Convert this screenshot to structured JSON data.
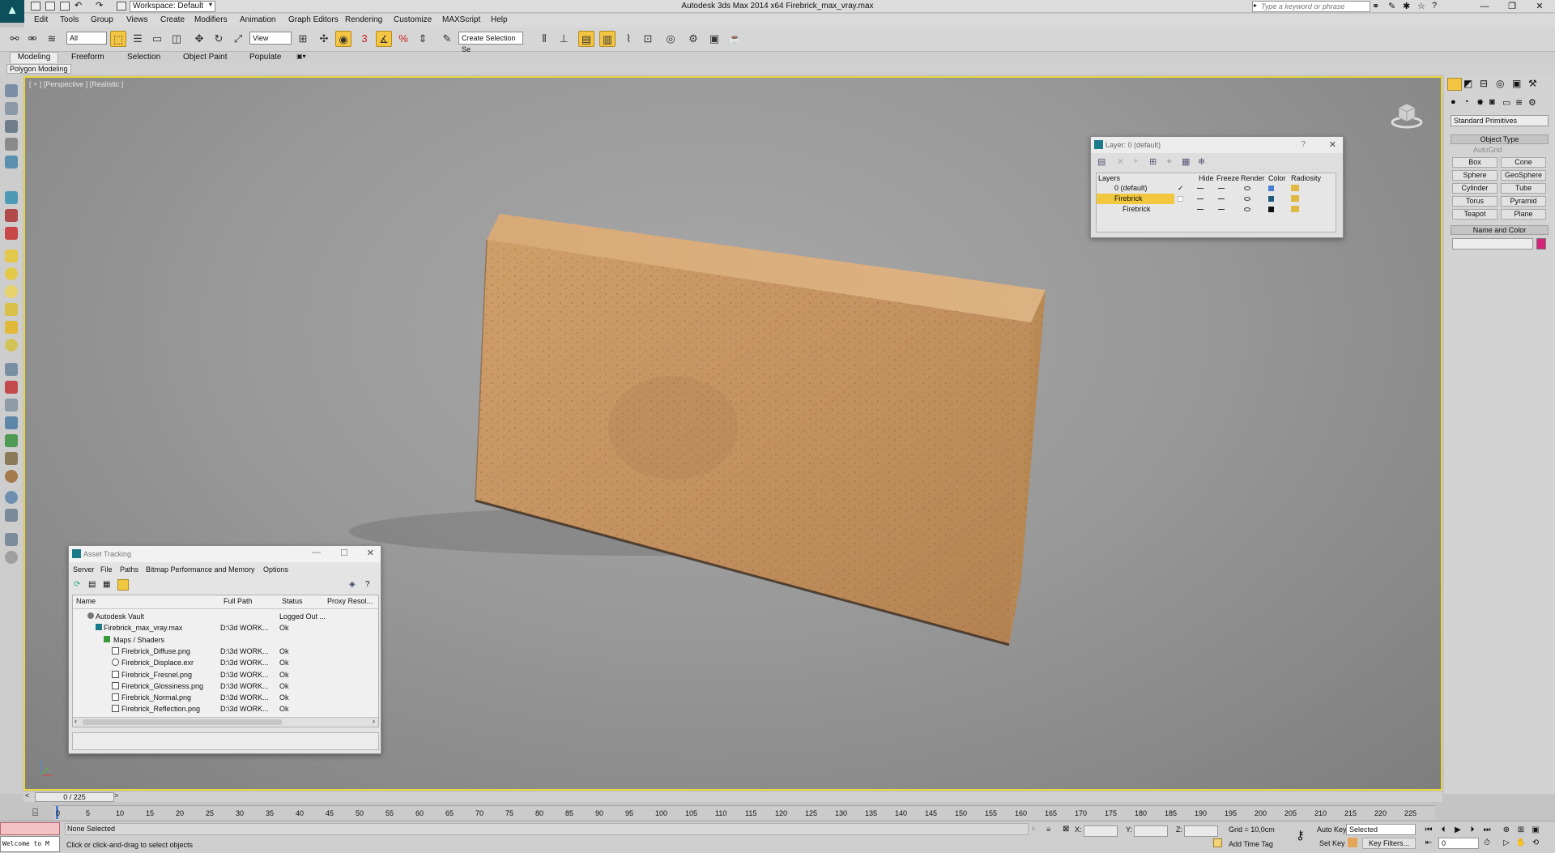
{
  "titlebar": {
    "workspace": "Workspace: Default",
    "title": "Autodesk 3ds Max  2014 x64      Firebrick_max_vray.max",
    "search_placeholder": "Type a keyword or phrase",
    "minimize": "—",
    "restore": "❐",
    "close": "✕"
  },
  "menu": [
    "Edit",
    "Tools",
    "Group",
    "Views",
    "Create",
    "Modifiers",
    "Animation",
    "Graph Editors",
    "Rendering",
    "Customize",
    "MAXScript",
    "Help"
  ],
  "toolbar": {
    "filter": "All",
    "ref_coord": "View",
    "selection_set": "Create Selection Se",
    "snap_label": "3"
  },
  "ribbon": {
    "tabs": [
      "Modeling",
      "Freeform",
      "Selection",
      "Object Paint",
      "Populate"
    ],
    "sub_label": "Polygon Modeling"
  },
  "viewport": {
    "label": "[ + ] [Perspective ] [Realistic ]"
  },
  "layer_dialog": {
    "title": "Layer: 0 (default)",
    "help": "?",
    "close": "✕",
    "columns": [
      "Layers",
      "Hide",
      "Freeze",
      "Render",
      "Color",
      "Radiosity"
    ],
    "rows": [
      {
        "name": "0 (default)",
        "check": "✓",
        "color": "#4a7fd0"
      },
      {
        "name": "Firebrick",
        "check": "",
        "color": "#1e5c7c"
      },
      {
        "name": "Firebrick",
        "check": "",
        "color": "#111111"
      }
    ],
    "collapse": "⊟"
  },
  "asset_tracking": {
    "title": "Asset Tracking",
    "menu": [
      "Server",
      "File",
      "Paths",
      "Bitmap Performance and Memory",
      "Options"
    ],
    "columns": [
      "Name",
      "Full Path",
      "Status",
      "Proxy Resol..."
    ],
    "rows": [
      {
        "name": "Autodesk Vault",
        "path": "",
        "status": "Logged Out ..."
      },
      {
        "name": "Firebrick_max_vray.max",
        "path": "D:\\3d WORK...",
        "status": "Ok"
      },
      {
        "name": "Maps / Shaders",
        "path": "",
        "status": ""
      },
      {
        "name": "Firebrick_Diffuse.png",
        "path": "D:\\3d WORK...",
        "status": "Ok"
      },
      {
        "name": "Firebrick_Displace.exr",
        "path": "D:\\3d WORK...",
        "status": "Ok"
      },
      {
        "name": "Firebrick_Fresnel.png",
        "path": "D:\\3d WORK...",
        "status": "Ok"
      },
      {
        "name": "Firebrick_Glossiness.png",
        "path": "D:\\3d WORK...",
        "status": "Ok"
      },
      {
        "name": "Firebrick_Normal.png",
        "path": "D:\\3d WORK...",
        "status": "Ok"
      },
      {
        "name": "Firebrick_Reflection.png",
        "path": "D:\\3d WORK...",
        "status": "Ok"
      }
    ]
  },
  "command_panel": {
    "category": "Standard Primitives",
    "object_type": "Object Type",
    "autogrid": "AutoGrid",
    "buttons": [
      "Box",
      "Cone",
      "Sphere",
      "GeoSphere",
      "Cylinder",
      "Tube",
      "Torus",
      "Pyramid",
      "Teapot",
      "Plane"
    ],
    "name_and_color": "Name and Color",
    "object_color": "#d6247a"
  },
  "timeline": {
    "frame": "0 / 225",
    "ticks": [
      "0",
      "5",
      "10",
      "15",
      "20",
      "25",
      "30",
      "35",
      "40",
      "45",
      "50",
      "55",
      "60",
      "65",
      "70",
      "75",
      "80",
      "85",
      "90",
      "95",
      "100",
      "105",
      "110",
      "115",
      "120",
      "125",
      "130",
      "135",
      "140",
      "145",
      "150",
      "155",
      "160",
      "165",
      "170",
      "175",
      "180",
      "185",
      "190",
      "195",
      "200",
      "205",
      "210",
      "215",
      "220",
      "225"
    ]
  },
  "status": {
    "maxscript": "Welcome to M",
    "selection": "None Selected",
    "prompt": "Click or click-and-drag to select objects",
    "x_label": "X:",
    "y_label": "Y:",
    "z_label": "Z:",
    "grid": "Grid = 10,0cm",
    "add_time_tag": "Add Time Tag",
    "auto_key": "Auto Key",
    "set_key": "Set Key",
    "key_mode": "Selected",
    "key_filters": "Key Filters...",
    "frame_field": "0"
  }
}
